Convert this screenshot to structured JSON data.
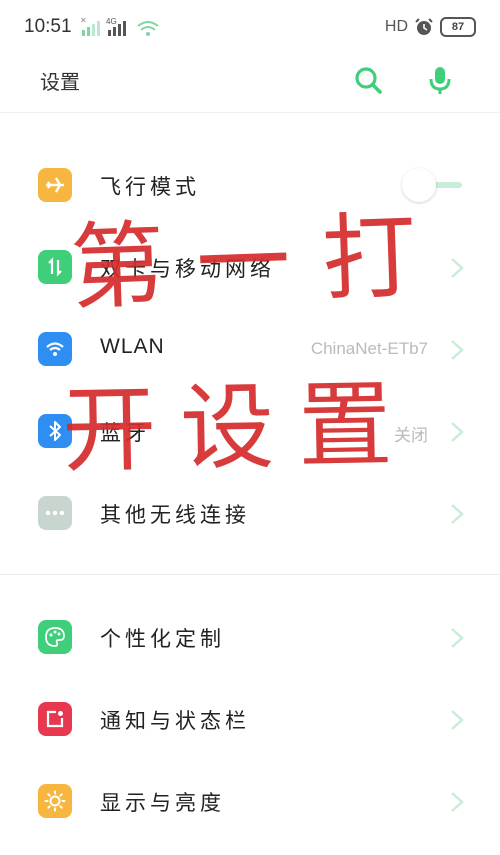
{
  "status_bar": {
    "time": "10:51",
    "hd_label": "HD",
    "battery": "87"
  },
  "header": {
    "title": "设置"
  },
  "settings": {
    "airplane": {
      "label": "飞行模式",
      "icon": "airplane-icon",
      "color": "#f6b640"
    },
    "dual_sim": {
      "label": "双卡与移动网络",
      "icon": "dual-arrow-icon",
      "color": "#3fcf7a"
    },
    "wlan": {
      "label": "WLAN",
      "value": "ChinaNet-ETb7",
      "icon": "wifi-icon",
      "color": "#2f8ef2"
    },
    "bluetooth": {
      "label": "蓝牙",
      "value": "关闭",
      "icon": "bluetooth-icon",
      "color": "#2f8ef2"
    },
    "other_wireless": {
      "label": "其他无线连接",
      "icon": "more-icon",
      "color": "#c9d6d0"
    },
    "personalize": {
      "label": "个性化定制",
      "icon": "palette-icon",
      "color": "#3fcf7a"
    },
    "notifications": {
      "label": "通知与状态栏",
      "icon": "notification-icon",
      "color": "#e8384f"
    },
    "display": {
      "label": "显示与亮度",
      "icon": "brightness-icon",
      "color": "#f6b640"
    }
  },
  "overlay": {
    "line1": "第一打",
    "line2": "开设置",
    "color": "#d42b2b"
  },
  "accent_color": "#3fcf7a"
}
